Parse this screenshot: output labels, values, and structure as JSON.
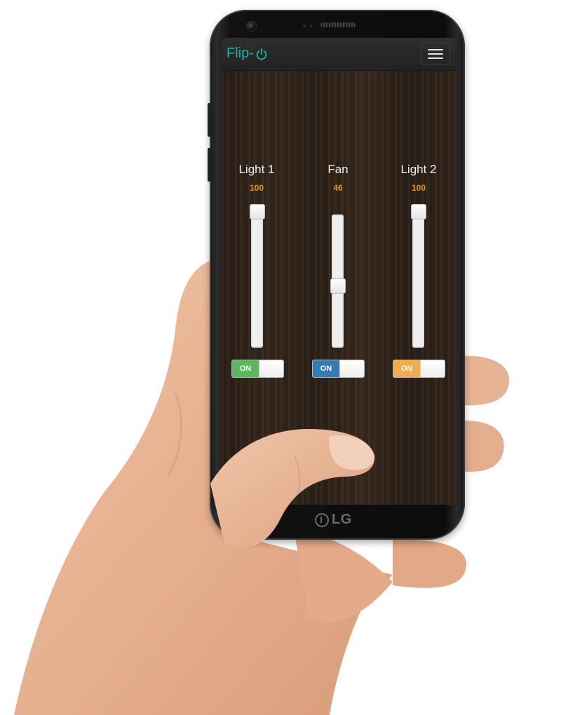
{
  "app": {
    "logo_text": "Flip-",
    "brand_text": "LG"
  },
  "devices": [
    {
      "name": "Light 1",
      "value": "100",
      "level": 1.0,
      "toggle_label": "ON",
      "toggle_color": "#5cb85c"
    },
    {
      "name": "Fan",
      "value": "46",
      "level": 0.46,
      "toggle_label": "ON",
      "toggle_color": "#337ab7"
    },
    {
      "name": "Light 2",
      "value": "100",
      "level": 1.0,
      "toggle_label": "ON",
      "toggle_color": "#f0ad4e"
    }
  ],
  "colors": {
    "logo": "#1fb3a8",
    "value_text": "#e5921f",
    "navbar": "#2a2a2a"
  },
  "icons": {
    "menu": "hamburger-menu-icon",
    "power": "power-icon"
  }
}
